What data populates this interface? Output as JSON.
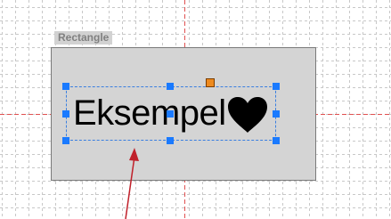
{
  "element": {
    "type_label": "Rectangle",
    "text": "Eksempel",
    "symbol_icon": "heart-icon"
  },
  "colors": {
    "rectangle_fill": "#d4d4d4",
    "selection": "#1a7aff",
    "rotate_handle": "#ee8a1e",
    "guide_line": "#e05050",
    "arrow": "#c0202a"
  }
}
